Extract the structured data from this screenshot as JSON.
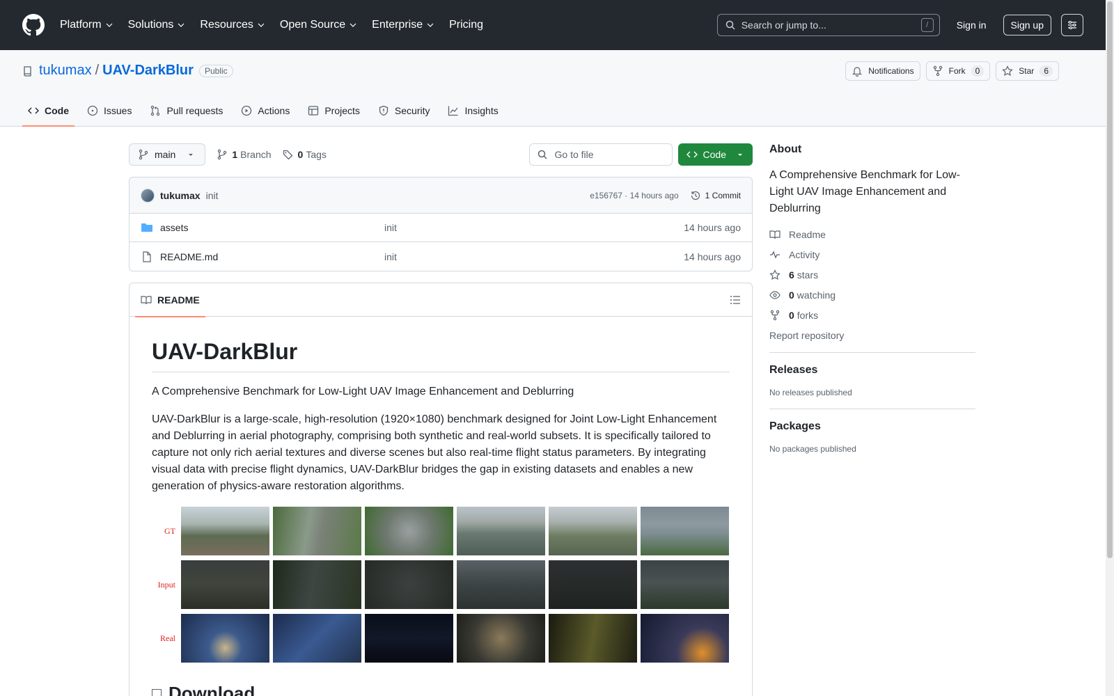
{
  "header": {
    "nav": [
      "Platform",
      "Solutions",
      "Resources",
      "Open Source",
      "Enterprise",
      "Pricing"
    ],
    "search_placeholder": "Search or jump to...",
    "search_key": "/",
    "signin": "Sign in",
    "signup": "Sign up"
  },
  "repo": {
    "owner": "tukumax",
    "separator": "/",
    "name": "UAV-DarkBlur",
    "visibility": "Public",
    "notifications": "Notifications",
    "fork_label": "Fork",
    "fork_count": "0",
    "star_label": "Star",
    "star_count": "6"
  },
  "tabs": [
    "Code",
    "Issues",
    "Pull requests",
    "Actions",
    "Projects",
    "Security",
    "Insights"
  ],
  "toolbar": {
    "branch": "main",
    "branch_count": "1",
    "branch_label": "Branch",
    "tag_count": "0",
    "tag_label": "Tags",
    "goto_placeholder": "Go to file",
    "code_btn": "Code"
  },
  "commit": {
    "author": "tukumax",
    "message": "init",
    "hash_time": "e156767 · 14 hours ago",
    "count": "1 Commit"
  },
  "files": [
    {
      "name": "assets",
      "type": "folder",
      "message": "init",
      "time": "14 hours ago"
    },
    {
      "name": "README.md",
      "type": "file",
      "message": "init",
      "time": "14 hours ago"
    }
  ],
  "readme": {
    "tab_label": "README",
    "title": "UAV-DarkBlur",
    "subtitle": "A Comprehensive Benchmark for Low-Light UAV Image Enhancement and Deblurring",
    "body": "UAV-DarkBlur is a large-scale, high-resolution (1920×1080) benchmark designed for Joint Low-Light Enhancement and Deblurring in aerial photography, comprising both synthetic and real-world subsets. It is specifically tailored to capture not only rich aerial textures and diverse scenes but also real-time flight status parameters. By integrating visual data with precise flight dynamics, UAV-DarkBlur bridges the gap in existing datasets and enables a new generation of physics-aware restoration algorithms.",
    "grid_rows": [
      "GT",
      "Input",
      "Real"
    ],
    "next_heading": "Download"
  },
  "about": {
    "title": "About",
    "description": "A Comprehensive Benchmark for Low-Light UAV Image Enhancement and Deblurring",
    "readme": "Readme",
    "activity": "Activity",
    "stars_count": "6",
    "stars_label": "stars",
    "watching_count": "0",
    "watching_label": "watching",
    "forks_count": "0",
    "forks_label": "forks",
    "report": "Report repository",
    "releases_title": "Releases",
    "releases_text": "No releases published",
    "packages_title": "Packages",
    "packages_text": "No packages published"
  },
  "colors": {
    "header_bg": "#24292f",
    "link": "#0969da",
    "code_button": "#1f883d",
    "tab_underline": "#fd8c73",
    "row_label": "#e0201d"
  }
}
